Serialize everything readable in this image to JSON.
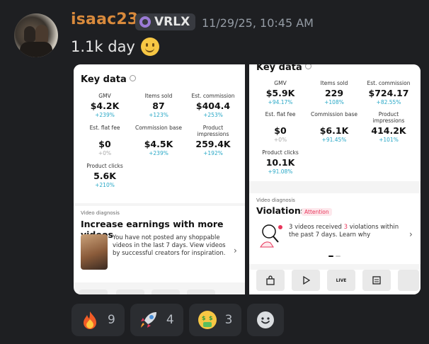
{
  "author": {
    "name": "isaac23",
    "tag": "VRLX",
    "timestamp": "11/29/25, 10:45 AM"
  },
  "message": {
    "text": "1.1k day"
  },
  "left_screenshot": {
    "key_data_title": "Key data",
    "metrics": [
      {
        "label": "GMV",
        "value": "$4.2K",
        "change": "+239%"
      },
      {
        "label": "Items sold",
        "value": "87",
        "change": "+123%"
      },
      {
        "label": "Est. commission",
        "value": "$404.4",
        "change": "+253%"
      },
      {
        "label": "Est. flat fee",
        "value": "$0",
        "change": "+0%"
      },
      {
        "label": "Commission base",
        "value": "$4.5K",
        "change": "+239%"
      },
      {
        "label": "Product impressions",
        "value": "259.4K",
        "change": "+192%"
      },
      {
        "label": "Product clicks",
        "value": "5.6K",
        "change": "+210%"
      }
    ],
    "diagnosis_label": "Video diagnosis",
    "diagnosis_title": "Increase earnings with more videos",
    "diagnosis_text": "You have not posted any shoppable videos in the last 7 days. View videos by successful creators for inspiration."
  },
  "right_screenshot": {
    "key_data_title": "Key data",
    "metrics": [
      {
        "label": "GMV",
        "value": "$5.9K",
        "change": "+94.17%"
      },
      {
        "label": "Items sold",
        "value": "229",
        "change": "+108%"
      },
      {
        "label": "Est. commission",
        "value": "$724.17",
        "change": "+82.55%"
      },
      {
        "label": "Est. flat fee",
        "value": "$0",
        "change": "+0%"
      },
      {
        "label": "Commission base",
        "value": "$6.1K",
        "change": "+91.45%"
      },
      {
        "label": "Product impressions",
        "value": "414.2K",
        "change": "+101%"
      },
      {
        "label": "Product clicks",
        "value": "10.1K",
        "change": "+91.08%"
      }
    ],
    "diagnosis_label": "Video diagnosis",
    "violations_title": "Violations",
    "attention_badge": "Attention",
    "violations_text_pre": "3 videos received ",
    "violations_count": "3",
    "violations_text_post": " violations within the past 7 days. Learn why",
    "live_label": "LIVE"
  },
  "reactions": [
    {
      "emoji": "fire-icon",
      "count": "9"
    },
    {
      "emoji": "rocket-icon",
      "count": "4"
    },
    {
      "emoji": "money-mouth-face-icon",
      "count": "3"
    }
  ],
  "colors": {
    "background": "#1e1f22",
    "username": "#d98a3c",
    "change": "#27a7c6",
    "attention": "#e8365b"
  }
}
